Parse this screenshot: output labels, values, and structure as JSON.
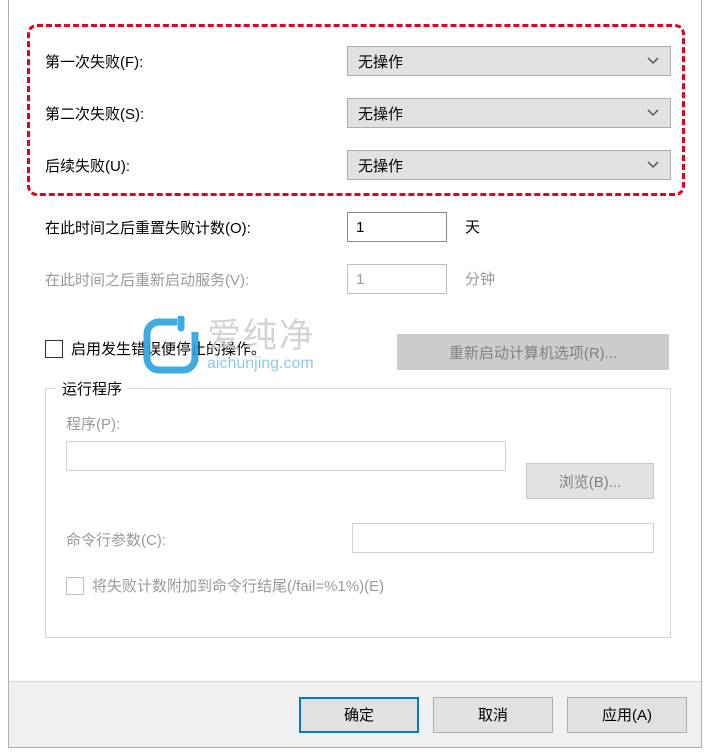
{
  "failure": {
    "first": {
      "label": "第一次失败(F):",
      "value": "无操作"
    },
    "second": {
      "label": "第二次失败(S):",
      "value": "无操作"
    },
    "subsequent": {
      "label": "后续失败(U):",
      "value": "无操作"
    }
  },
  "reset_count": {
    "label": "在此时间之后重置失败计数(O):",
    "value": "1",
    "unit": "天"
  },
  "restart_service": {
    "label": "在此时间之后重新启动服务(V):",
    "value": "1",
    "unit": "分钟"
  },
  "enable_stop_error": {
    "label": "启用发生错误便停止的操作。"
  },
  "restart_computer_btn": "重新启动计算机选项(R)...",
  "group": {
    "title": "运行程序",
    "program_label": "程序(P):",
    "browse_btn": "浏览(B)...",
    "cmdline_label": "命令行参数(C):",
    "append_fail_label": "将失败计数附加到命令行结尾(/fail=%1%)(E)"
  },
  "footer": {
    "ok": "确定",
    "cancel": "取消",
    "apply": "应用(A)"
  },
  "watermark": {
    "cn": "爱纯净",
    "en": "aichunjing.com"
  }
}
